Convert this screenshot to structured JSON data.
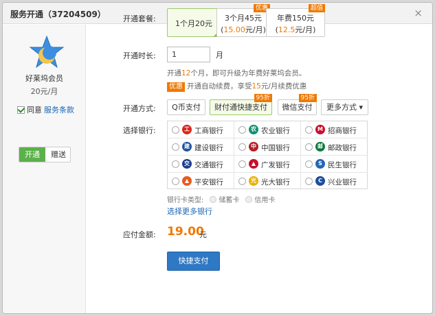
{
  "dialog": {
    "title": "服务开通（37204509）",
    "close": "×"
  },
  "product": {
    "name": "好莱坞会员",
    "price": "20元/月",
    "agree_label": "同意",
    "terms_link": "服务条款"
  },
  "mode_toggle": {
    "open": "开通",
    "gift": "赠送"
  },
  "package": {
    "label": "开通套餐:",
    "options": [
      {
        "line1": "1个月20元",
        "line2": "",
        "selected": true,
        "tag": ""
      },
      {
        "line1": "3个月45元",
        "price": "15.00",
        "unit": "元/月",
        "tag": "优惠"
      },
      {
        "line1": "年费150元",
        "price": "12.5",
        "unit": "元/月",
        "tag": "超值"
      }
    ]
  },
  "duration": {
    "label": "开通时长:",
    "value": "1",
    "unit": "月",
    "hint_a": "开通",
    "hint_num": "12",
    "hint_b": "个月，即可升级为年费好莱坞会员。",
    "badge": "优惠",
    "renew_a": "开通自动续费，享受",
    "renew_num": "15",
    "renew_b": "元/月续费优惠"
  },
  "payment": {
    "label": "开通方式:",
    "options": [
      {
        "text": "Q币支付",
        "tag": ""
      },
      {
        "text": "财付通快捷支付",
        "tag": "95折"
      },
      {
        "text": "微信支付",
        "tag": "95折"
      },
      {
        "text": "更多方式 ▾",
        "tag": ""
      }
    ]
  },
  "banks": {
    "label": "选择银行:",
    "items": [
      {
        "name": "工商银行",
        "icon": "icbc-icon",
        "color": "#d9261c",
        "glyph": "工"
      },
      {
        "name": "农业银行",
        "icon": "abc-icon",
        "color": "#0f8f6f",
        "glyph": "农"
      },
      {
        "name": "招商银行",
        "icon": "cmb-icon",
        "color": "#c8102e",
        "glyph": "M"
      },
      {
        "name": "建设银行",
        "icon": "ccb-icon",
        "color": "#1e56a0",
        "glyph": "建"
      },
      {
        "name": "中国银行",
        "icon": "boc-icon",
        "color": "#b41e24",
        "glyph": "中"
      },
      {
        "name": "邮政银行",
        "icon": "psbc-icon",
        "color": "#0b7a3a",
        "glyph": "邮"
      },
      {
        "name": "交通银行",
        "icon": "bocom-icon",
        "color": "#1f3f8f",
        "glyph": "交"
      },
      {
        "name": "广发银行",
        "icon": "cgb-icon",
        "color": "#c8102e",
        "glyph": "▲"
      },
      {
        "name": "民生银行",
        "icon": "cmbc-icon",
        "color": "#2466b5",
        "glyph": "S"
      },
      {
        "name": "平安银行",
        "icon": "pingan-icon",
        "color": "#e75b1e",
        "glyph": "▲"
      },
      {
        "name": "光大银行",
        "icon": "ceb-icon",
        "color": "#e8b100",
        "glyph": "光"
      },
      {
        "name": "兴业银行",
        "icon": "cib-icon",
        "color": "#1f4e9c",
        "glyph": "C"
      }
    ]
  },
  "card_type": {
    "label": "银行卡类型:",
    "debit": "储蓄卡",
    "credit": "信用卡"
  },
  "more_banks": "选择更多银行",
  "amount": {
    "label": "应付金额:",
    "value": "19.00",
    "unit": "元"
  },
  "submit": "快捷支付",
  "colors": {
    "accent": "#f07800",
    "link": "#1a64b3",
    "button": "#2e78c4",
    "green": "#5bb14a"
  }
}
